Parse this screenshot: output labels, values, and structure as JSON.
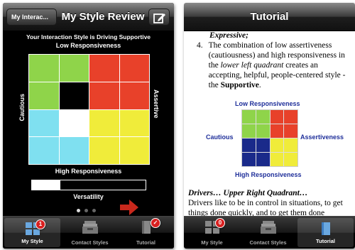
{
  "left": {
    "nav": {
      "back_label": "My Interac...",
      "title": "My Style Review"
    },
    "style_line": "Your Interaction Style is  Driving Supportive",
    "low_responsiveness": "Low Responsiveness",
    "high_responsiveness": "High Responsiveness",
    "cautious": "Cautious",
    "assertive": "Assertive",
    "versatility_label": "Versatility",
    "versatility_fraction": 0.25,
    "grid_cells": [
      "#8fd44a",
      "#8fd44a",
      "#e8412a",
      "#e8412a",
      "#8fd44a",
      "#000000",
      "#e8412a",
      "#e8412a",
      "#7fe0f0",
      "#ffffff",
      "#f0ec3a",
      "#f0ec3a",
      "#7fe0f0",
      "#7fe0f0",
      "#f0ec3a",
      "#f0ec3a"
    ],
    "page_dots": 3,
    "page_active": 0,
    "tabs": [
      {
        "label": "My Style",
        "badge": "1",
        "icon": "grid-icon",
        "selected": true
      },
      {
        "label": "Contact Styles",
        "badge": "",
        "icon": "card-stack-icon",
        "selected": false
      },
      {
        "label": "Tutorial",
        "badge": "✓",
        "icon": "book-icon",
        "selected": false
      }
    ]
  },
  "right": {
    "nav": {
      "title": "Tutorial"
    },
    "top_fragment": "Expressive;",
    "item_number": "4.",
    "item_text_1": "The combination of low assertiveness (cautiousness) and high responsiveness in the ",
    "item_italic": "lower left quadrant",
    "item_text_2": " creates an accepting, helpful, people-centered style - the ",
    "item_bold": "Supportive",
    "item_end": ".",
    "low_responsiveness": "Low Responsiveness",
    "high_responsiveness": "High Responsiveness",
    "cautious": "Cautious",
    "assertiveness": "Assertiveness",
    "grid_cells": [
      "#8fd44a",
      "#8fd44a",
      "#e8412a",
      "#e8412a",
      "#8fd44a",
      "#8fd44a",
      "#e8412a",
      "#e8412a",
      "#1a2a8a",
      "#1a2a8a",
      "#f0ec3a",
      "#f0ec3a",
      "#1a2a8a",
      "#1a2a8a",
      "#f0ec3a",
      "#f0ec3a"
    ],
    "heading": "Drivers… Upper Right Quadrant…",
    "body": "Drivers like to be in control in situations, to get things done quickly, and to get them done",
    "tabs": [
      {
        "label": "My Style",
        "badge": "0",
        "icon": "grid-icon",
        "selected": false
      },
      {
        "label": "Contact Styles",
        "badge": "",
        "icon": "card-stack-icon",
        "selected": false
      },
      {
        "label": "Tutorial",
        "badge": "",
        "icon": "book-icon",
        "selected": true
      }
    ]
  },
  "colors": {
    "badge_red": "#d92020",
    "arrow_red": "#c8281c",
    "label_blue": "#1f2f9a"
  }
}
